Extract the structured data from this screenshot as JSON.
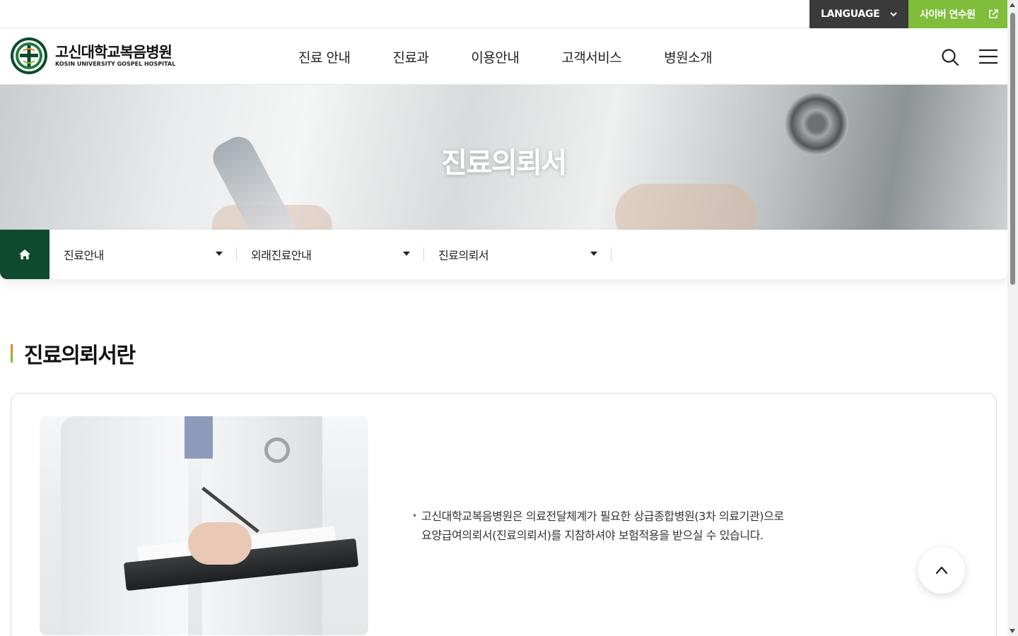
{
  "utility": {
    "language_label": "LANGUAGE",
    "cyber_label": "사이버 연수원"
  },
  "header": {
    "logo_ko": "고신대학교복음병원",
    "logo_en": "KOSIN UNIVERSITY GOSPEL HOSPITAL",
    "nav": [
      "진료 안내",
      "진료과",
      "이용안내",
      "고객서비스",
      "병원소개"
    ]
  },
  "hero": {
    "title": "진료의뢰서"
  },
  "breadcrumb": {
    "items": [
      "진료안내",
      "외래진료안내",
      "진료의뢰서"
    ]
  },
  "content": {
    "section_title": "진료의뢰서란",
    "bullet": "•",
    "desc_line1": "고신대학교복음병원은 의료전달체계가 필요한 상급종합병원(3차 의료기관)으로",
    "desc_line2": "요양급여의뢰서(진료의뢰서)를 지참하셔야 보험적용을 받으실 수 있습니다."
  },
  "colors": {
    "brand_green": "#0d4a2e",
    "accent_green": "#7fbd3a",
    "accent_orange": "#e8872a",
    "dark_gray": "#3a3a3a"
  }
}
